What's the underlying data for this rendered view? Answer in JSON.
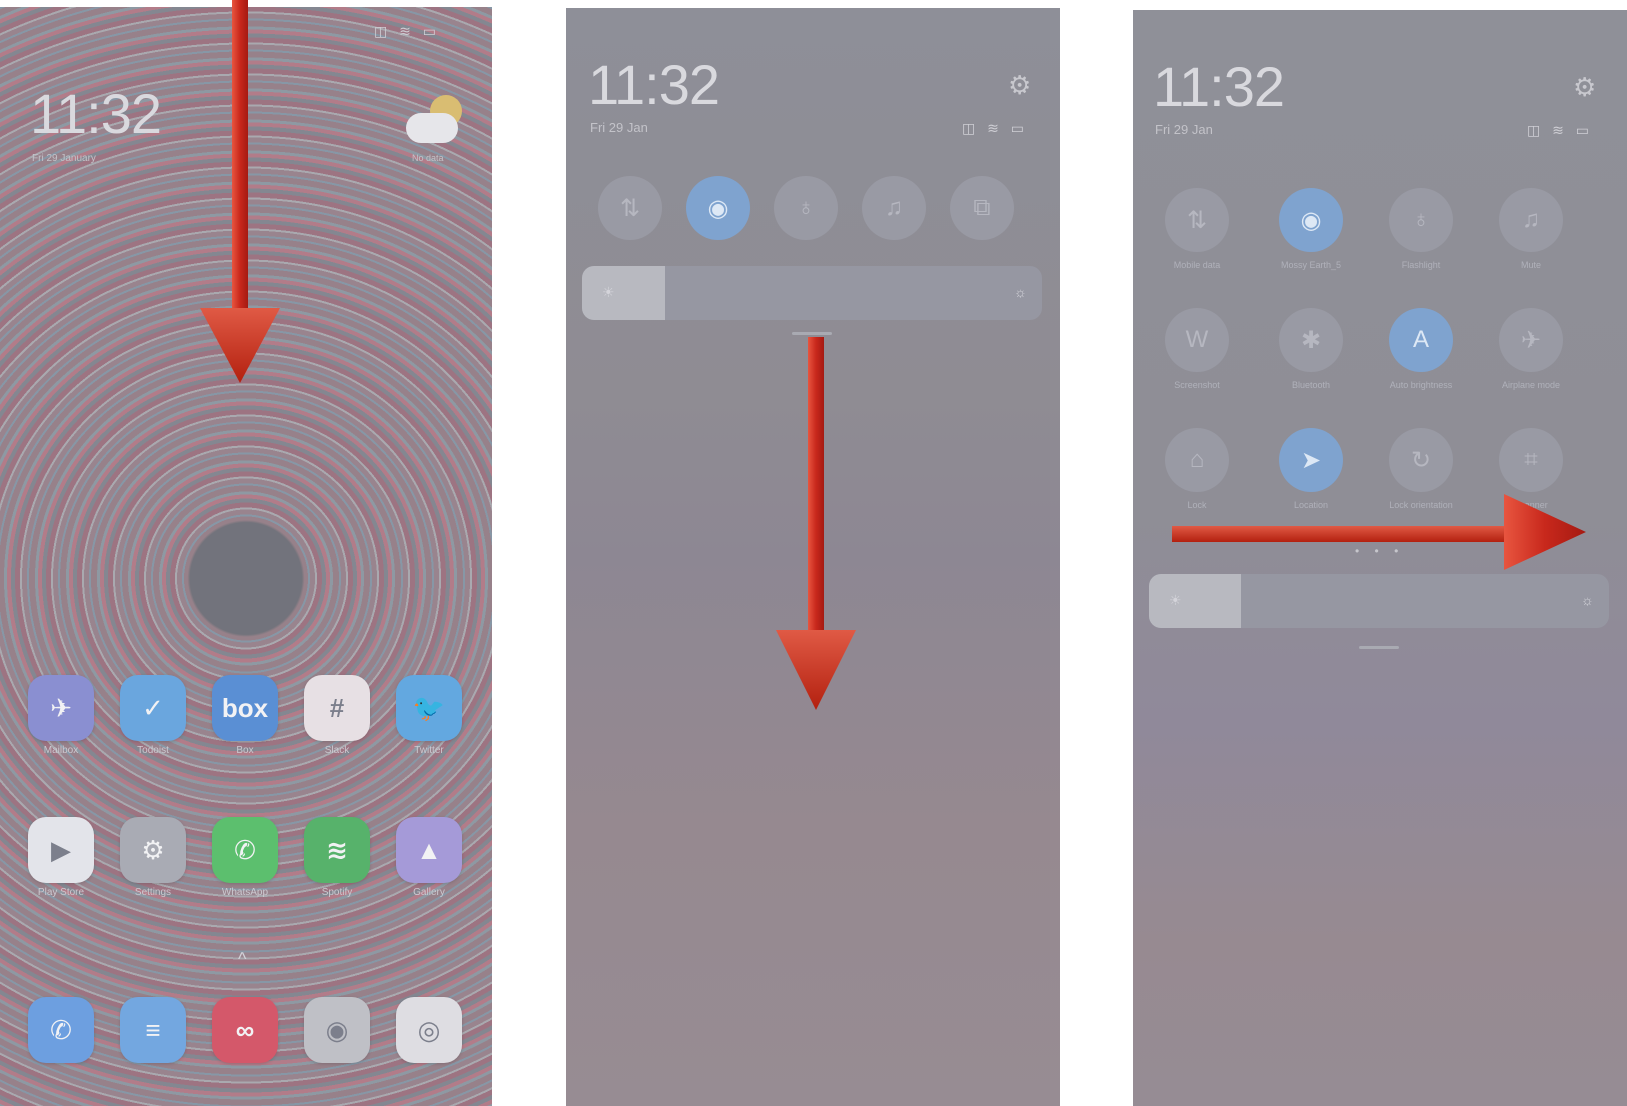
{
  "colors": {
    "accent_blue": "#7fa3cf",
    "arrow_red": "#c8281c",
    "toggle_off": "#999aa4"
  },
  "panel1": {
    "time": "11:32",
    "date": "Fri 29 January",
    "status": "◫ ≋ ▭",
    "weather_label": "No data",
    "apps_row1": [
      {
        "label": "Mailbox",
        "glyph": "✈",
        "color": "#8a8fd1",
        "icon": "paper-plane-icon"
      },
      {
        "label": "Todoist",
        "glyph": "✓",
        "color": "#6aa6de",
        "icon": "check-icon"
      },
      {
        "label": "Box",
        "glyph": "box",
        "color": "#5a8fd4",
        "icon": "box-logo-icon"
      },
      {
        "label": "Slack",
        "glyph": "#",
        "color": "#e7e0e4",
        "icon": "slack-logo-icon"
      },
      {
        "label": "Twitter",
        "glyph": "🐦",
        "color": "#63a8e0",
        "icon": "bird-icon"
      }
    ],
    "apps_row2": [
      {
        "label": "Play Store",
        "glyph": "▶",
        "color": "#e3e4ea",
        "icon": "play-store-icon"
      },
      {
        "label": "Settings",
        "glyph": "⚙",
        "color": "#a9abb4",
        "icon": "gear-icon"
      },
      {
        "label": "WhatsApp",
        "glyph": "✆",
        "color": "#5cbf6e",
        "icon": "whatsapp-icon"
      },
      {
        "label": "Spotify",
        "glyph": "≋",
        "color": "#57b26b",
        "icon": "spotify-icon"
      },
      {
        "label": "Gallery",
        "glyph": "▲",
        "color": "#a59ad8",
        "icon": "gallery-icon"
      }
    ],
    "dock": [
      {
        "glyph": "✆",
        "color": "#6d9fe0",
        "icon": "phone-icon"
      },
      {
        "glyph": "≡",
        "color": "#73a7e0",
        "icon": "notes-icon"
      },
      {
        "glyph": "∞",
        "color": "#d4586a",
        "icon": "authy-icon"
      },
      {
        "glyph": "◉",
        "color": "#bfc0c6",
        "icon": "camera-icon"
      },
      {
        "glyph": "◎",
        "color": "#dedde2",
        "icon": "chrome-icon"
      }
    ],
    "chevron": "^"
  },
  "panel2": {
    "time": "11:32",
    "date": "Fri 29 Jan",
    "status": "◫ ≋ ▭",
    "gear": "⚙",
    "toggles": [
      {
        "glyph": "⇅",
        "on": false,
        "icon": "mobile-data-icon"
      },
      {
        "glyph": "◉",
        "on": true,
        "icon": "wifi-icon"
      },
      {
        "glyph": "♁",
        "on": false,
        "icon": "flashlight-icon"
      },
      {
        "glyph": "♫",
        "on": false,
        "icon": "bell-icon"
      },
      {
        "glyph": "⧉",
        "on": false,
        "icon": "screenshot-icon"
      }
    ],
    "brightness_low": "☀",
    "brightness_high": "☼",
    "brightness_level": 0.18
  },
  "panel3": {
    "time": "11:32",
    "date": "Fri 29 Jan",
    "status": "◫ ≋ ▭",
    "gear": "⚙",
    "tiles": [
      {
        "glyph": "⇅",
        "label": "Mobile data",
        "on": false,
        "icon": "mobile-data-icon"
      },
      {
        "glyph": "◉",
        "label": "Mossy Earth_5",
        "on": true,
        "icon": "wifi-icon"
      },
      {
        "glyph": "♁",
        "label": "Flashlight",
        "on": false,
        "icon": "flashlight-icon"
      },
      {
        "glyph": "♫",
        "label": "Mute",
        "on": false,
        "icon": "bell-icon"
      },
      {
        "glyph": "W",
        "label": "Screenshot",
        "on": false,
        "icon": "screenshot-icon"
      },
      {
        "glyph": "✱",
        "label": "Bluetooth",
        "on": false,
        "icon": "bluetooth-icon"
      },
      {
        "glyph": "A",
        "label": "Auto brightness",
        "on": true,
        "icon": "auto-brightness-icon"
      },
      {
        "glyph": "✈",
        "label": "Airplane mode",
        "on": false,
        "icon": "airplane-icon"
      },
      {
        "glyph": "⌂",
        "label": "Lock",
        "on": false,
        "icon": "lock-icon"
      },
      {
        "glyph": "➤",
        "label": "Location",
        "on": true,
        "icon": "location-icon"
      },
      {
        "glyph": "↻",
        "label": "Lock orientation",
        "on": false,
        "icon": "rotation-lock-icon"
      },
      {
        "glyph": "⌗",
        "label": "Scanner",
        "on": false,
        "icon": "scanner-icon"
      }
    ],
    "page_dots": "• • •",
    "brightness_low": "☀",
    "brightness_high": "☼",
    "brightness_level": 0.2
  }
}
